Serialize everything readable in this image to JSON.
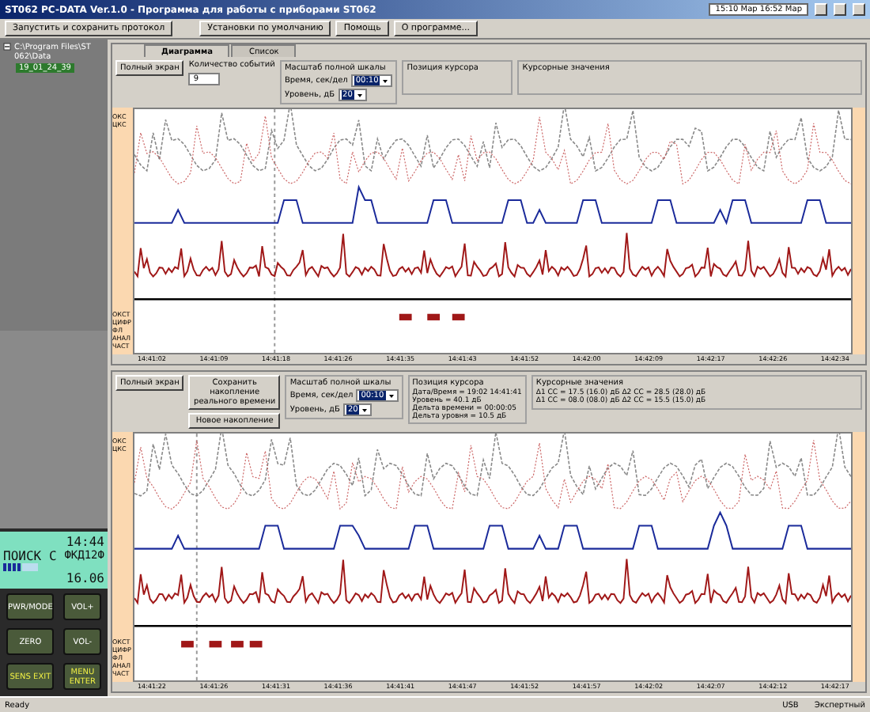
{
  "window": {
    "title": "ST062 PC-DATA Ver.1.0 - Программа для работы с приборами ST062",
    "date_range": "15:10 Мар 16:52 Мар"
  },
  "toolbar": [
    "Запустить и сохранить протокол",
    "Установки по умолчанию",
    "Помощь",
    "О программе..."
  ],
  "tree": {
    "label": "C:\\Program Files\\ST 062\\Data",
    "expanded": true,
    "children": [
      {
        "label": "19_01_24_39",
        "selected": true
      }
    ]
  },
  "device": {
    "time": "14:44",
    "mode": "ПОИСК",
    "channel": "С",
    "code": "ФКД12Ф",
    "reading": "16.06",
    "level": 0.55,
    "keys": [
      "PWR/MODE",
      "VOL+",
      "ZERO",
      "VOL-",
      "SENS EXIT",
      "MENU ENTER"
    ]
  },
  "panels": [
    {
      "tabs": [
        {
          "label": "Диаграмма",
          "selected": true
        },
        {
          "label": "Список",
          "selected": false
        }
      ],
      "buttons": [
        "Полный экран"
      ],
      "events": {
        "label": "Количество событий",
        "value": "9"
      },
      "scale": {
        "title": "Масштаб полной шкалы",
        "time_label": "Время, сек/дел",
        "time_value": "00:10",
        "level_label": "Уровень, дБ",
        "level_value": "20"
      },
      "cursor": {
        "title": "Позиция курсора"
      },
      "cursor_values": {
        "title": "Курсорные значения"
      },
      "labels_top": [
        "ОКС",
        "ЦКС"
      ],
      "labels_bottom": [
        "ОКСТ",
        "ЦИФР",
        "ФЛ",
        "АНАЛ",
        "ЧАСТ"
      ],
      "time_ticks": [
        "14:41:02",
        "14:41:09",
        "14:41:18",
        "14:41:26",
        "14:41:35",
        "14:41:43",
        "14:41:52",
        "14:42:00",
        "14:42:09",
        "14:42:17",
        "14:42:26",
        "14:42:34"
      ]
    },
    {
      "buttons": [
        "Полный экран",
        "Сохранить накопление реального времени",
        "Новое накопление"
      ],
      "scale": {
        "title": "Масштаб полной шкалы",
        "time_label": "Время, сек/дел",
        "time_value": "00:10",
        "level_label": "Уровень, дБ",
        "level_value": "20"
      },
      "cursor": {
        "title": "Позиция курсора",
        "lines": [
          "Дата/Время = 19:02 14:41:41",
          "Уровень = 40.1 дБ",
          "Дельта времени = 00:00:05",
          "Дельта уровня = 10.5 дБ"
        ]
      },
      "cursor_values": {
        "title": "Курсорные значения",
        "lines": [
          "Δ1 СС = 17.5 (16.0) дБ   Δ2 СС = 28.5 (28.0) дБ",
          "Δ1 СС = 08.0 (08.0) дБ   Δ2 СС = 15.5 (15.0) дБ"
        ]
      },
      "labels_top": [
        "ОКС",
        "ЦКС"
      ],
      "labels_bottom": [
        "ОКСТ",
        "ЦИФР",
        "ФЛ",
        "АНАЛ",
        "ЧАСТ"
      ],
      "time_ticks": [
        "14:41:22",
        "14:41:26",
        "14:41:31",
        "14:41:36",
        "14:41:41",
        "14:41:47",
        "14:41:52",
        "14:41:57",
        "14:42:02",
        "14:42:07",
        "14:42:12",
        "14:42:17"
      ]
    }
  ],
  "status_bar": [
    "Ready",
    "USB",
    "Экспертный"
  ]
}
